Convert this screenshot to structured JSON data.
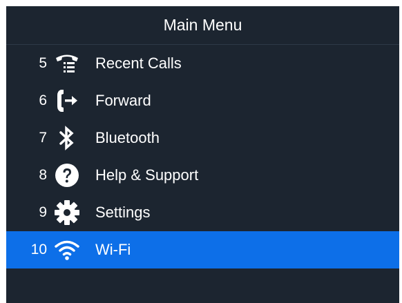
{
  "title": "Main Menu",
  "colors": {
    "background": "#1c2530",
    "selected": "#0d6fe8",
    "text": "#ffffff"
  },
  "items": [
    {
      "number": "5",
      "label": "Recent Calls",
      "icon": "recent-calls-icon"
    },
    {
      "number": "6",
      "label": "Forward",
      "icon": "forward-icon"
    },
    {
      "number": "7",
      "label": "Bluetooth",
      "icon": "bluetooth-icon"
    },
    {
      "number": "8",
      "label": "Help & Support",
      "icon": "help-icon"
    },
    {
      "number": "9",
      "label": "Settings",
      "icon": "gear-icon"
    },
    {
      "number": "10",
      "label": "Wi-Fi",
      "icon": "wifi-icon",
      "selected": true
    }
  ]
}
